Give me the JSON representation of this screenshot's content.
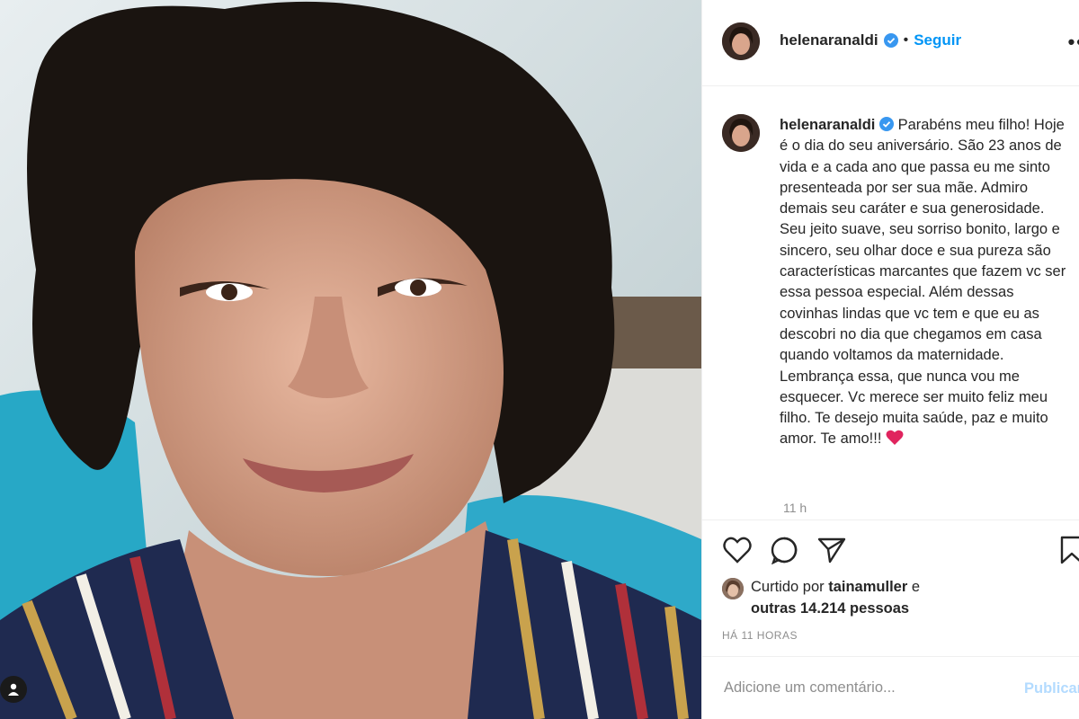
{
  "post": {
    "author": "helenaranaldi",
    "follow_label": "Seguir",
    "dot": "•",
    "more_icon": "more-options-icon",
    "more_label": "••",
    "caption_text": "Parabéns meu filho! Hoje é o dia do seu aniversário. São 23 anos de vida e a cada ano que passa eu me sinto presenteada por ser sua mãe. Admiro demais seu caráter e sua generosidade. Seu jeito suave, seu sorriso bonito, largo e sincero, seu olhar doce e sua pureza são características marcantes que fazem vc ser essa pessoa especial. Além dessas covinhas lindas que vc tem e que eu as descobri no dia que chegamos em casa quando voltamos da maternidade. Lembrança essa, que nunca vou me esquecer. Vc merece ser muito feliz meu filho. Te desejo muita saúde, paz e muito amor. Te amo!!!",
    "caption_emoji": "heart-emoji",
    "time": "11 h",
    "likes_prefix": "Curtido por",
    "likes_user": "tainamuller",
    "likes_conj": "e",
    "likes_others": "outras 14.214 pessoas",
    "ago": "HÁ 11 HORAS",
    "comment_placeholder": "Adicione um comentário...",
    "publish_label": "Publicar"
  },
  "icons": {
    "like": "heart-icon",
    "comment": "comment-icon",
    "share": "send-icon",
    "save": "bookmark-icon",
    "tag": "user-tag-icon",
    "verified": "verified-badge-icon"
  },
  "colors": {
    "accent": "#0095f6",
    "publish_disabled": "#b3dbff",
    "verified": "#3897f0",
    "muted": "#8e8e8e",
    "heart": "#ed4956"
  }
}
